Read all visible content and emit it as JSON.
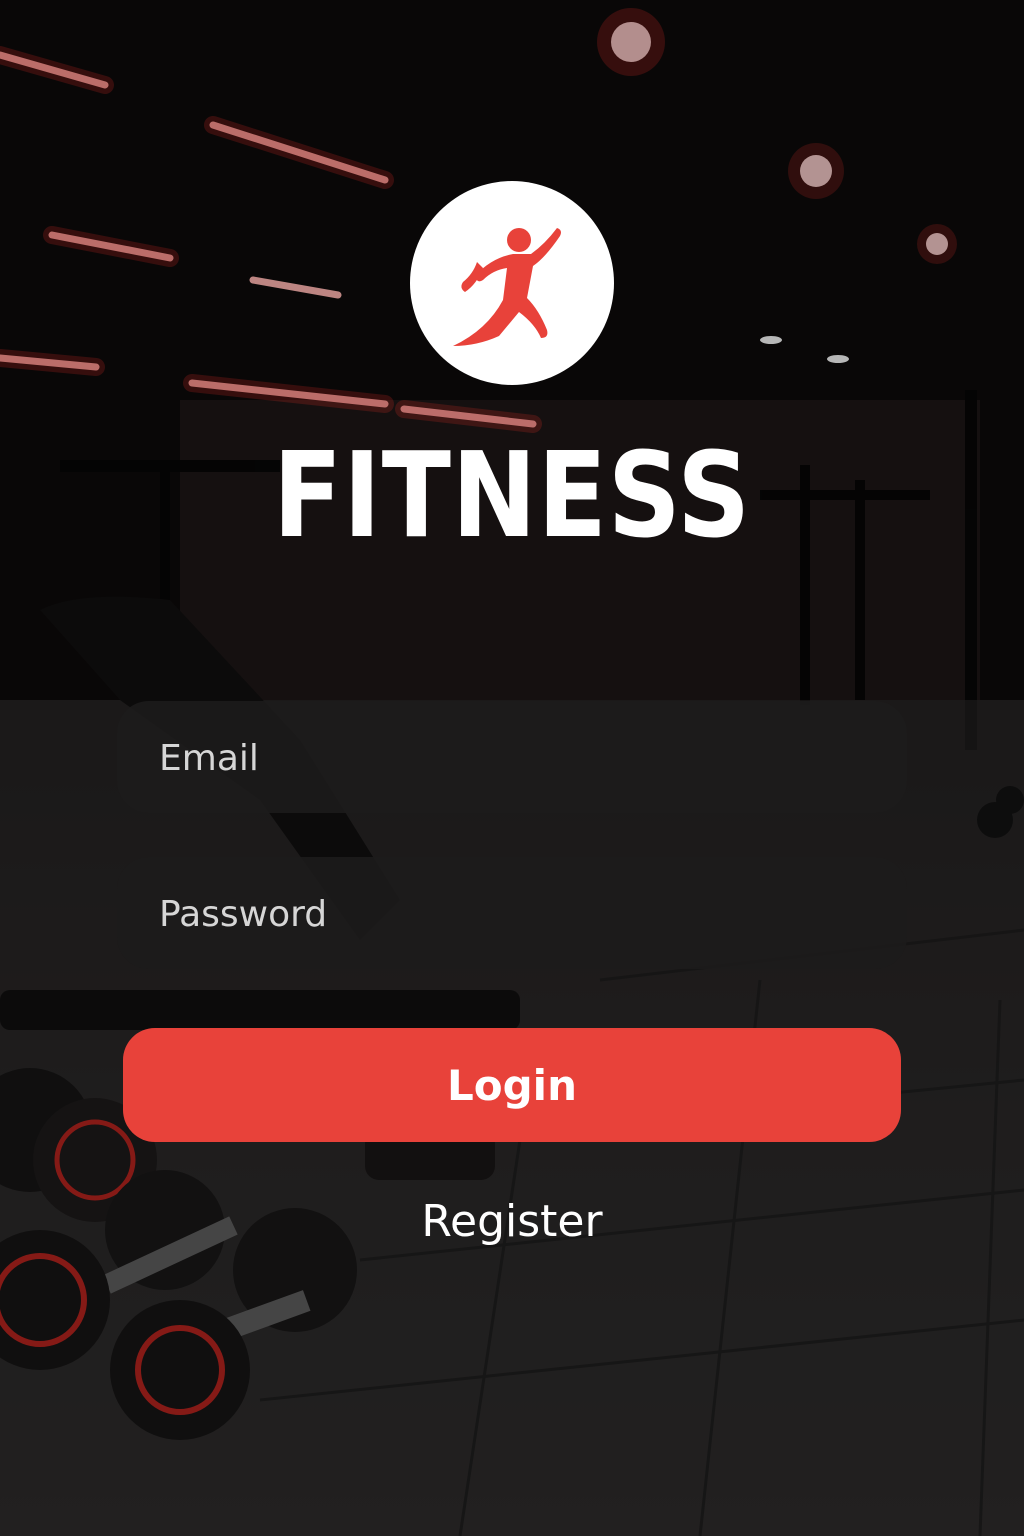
{
  "app": {
    "brand_name": "FITNESS",
    "logo_icon": "running-person-icon",
    "accent_color": "#e8423a"
  },
  "form": {
    "email_placeholder": "Email",
    "password_placeholder": "Password",
    "login_label": "Login",
    "register_label": "Register"
  }
}
